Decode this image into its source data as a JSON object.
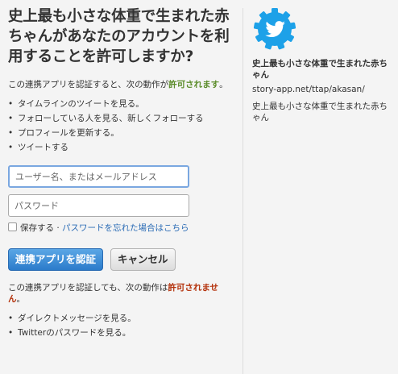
{
  "auth": {
    "title": "史上最も小さな体重で生まれた赤ちゃんがあなたのアカウントを利用することを許可しますか?",
    "allowed_lead_before": "この連携アプリを認証すると、次の動作が",
    "allowed_emph": "許可されます",
    "allowed_lead_after": "。",
    "allowed_items": [
      "タイムラインのツイートを見る。",
      "フォローしている人を見る、新しくフォローする",
      "プロフィールを更新する。",
      "ツイートする"
    ],
    "username_placeholder": "ユーザー名、またはメールアドレス",
    "password_placeholder": "パスワード",
    "remember_label": "保存する",
    "remember_sep": "·",
    "forgot_link": "パスワードを忘れた場合はこちら",
    "authorize_button": "連携アプリを認証",
    "cancel_button": "キャンセル",
    "denied_lead_before": "この連携アプリを認証しても、次の動作は",
    "denied_emph": "許可されません",
    "denied_lead_after": "。",
    "denied_items": [
      "ダイレクトメッセージを見る。",
      "Twitterのパスワードを見る。"
    ]
  },
  "app": {
    "logo_icon": "twitter-bird-gear-icon",
    "logo_color": "#1da1e8",
    "name": "史上最も小さな体重で生まれた赤ちゃん",
    "url": "story-app.net/ttap/akasan/",
    "description": "史上最も小さな体重で生まれた赤ちゃん"
  }
}
